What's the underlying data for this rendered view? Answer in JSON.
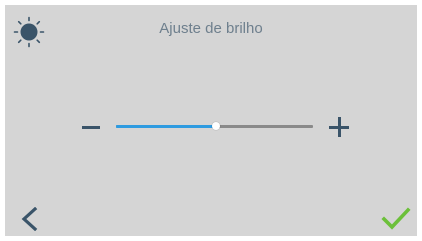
{
  "header": {
    "title": "Ajuste de brilho",
    "icon": "sun-icon"
  },
  "brightness": {
    "level_percent": 51,
    "decrease_icon": "minus-icon",
    "increase_icon": "plus-icon"
  },
  "footer": {
    "back_icon": "chevron-left-icon",
    "confirm_icon": "checkmark-icon"
  },
  "colors": {
    "background": "#d5d5d5",
    "title_text": "#6e7f8d",
    "icon_dark": "#3a5469",
    "slider_fill": "#2e9be0",
    "slider_track": "#8a8a8a",
    "confirm_green": "#6cc03a"
  }
}
